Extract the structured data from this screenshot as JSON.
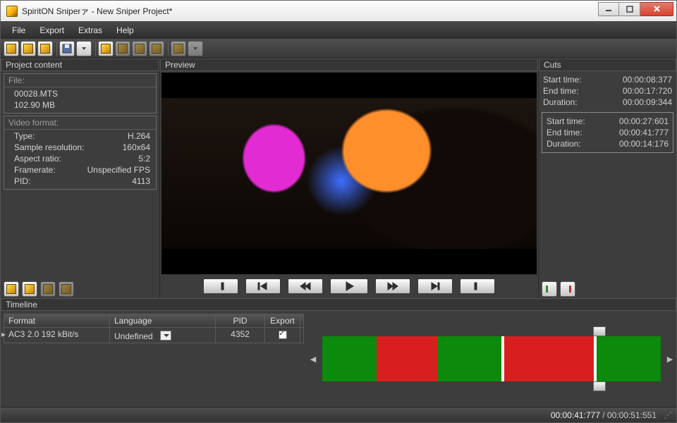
{
  "window": {
    "title": "SpiritON Sniperァ - New Sniper Project*"
  },
  "menubar": {
    "file": "File",
    "export": "Export",
    "extras": "Extras",
    "help": "Help"
  },
  "panes": {
    "project": "Project content",
    "preview": "Preview",
    "cuts": "Cuts",
    "timeline": "Timeline"
  },
  "project": {
    "file_head": "File:",
    "file_name": "00028.MTS",
    "file_size": "102.90 MB",
    "vf_head": "Video format:",
    "type_k": "Type:",
    "type_v": "H.264",
    "res_k": "Sample resolution:",
    "res_v": "160x64",
    "ar_k": "Aspect ratio:",
    "ar_v": "5:2",
    "fr_k": "Framerate:",
    "fr_v": "Unspecified FPS",
    "pid_k": "PID:",
    "pid_v": "4113"
  },
  "cuts": [
    {
      "start_k": "Start time:",
      "start_v": "00:00:08:377",
      "end_k": "End time:",
      "end_v": "00:00:17:720",
      "dur_k": "Duration:",
      "dur_v": "00:00:09:344",
      "selected": false
    },
    {
      "start_k": "Start time:",
      "start_v": "00:00:27:601",
      "end_k": "End time:",
      "end_v": "00:00:41:777",
      "dur_k": "Duration:",
      "dur_v": "00:00:14:176",
      "selected": true
    }
  ],
  "track_table": {
    "head": {
      "format": "Format",
      "language": "Language",
      "pid": "PID",
      "export": "Export"
    },
    "row": {
      "format": "AC3 2.0 192 kBit/s",
      "language": "Undefined",
      "pid": "4352",
      "export_checked": true
    }
  },
  "timeline": {
    "segments": [
      {
        "color": "g",
        "flex": 17
      },
      {
        "color": "r",
        "flex": 19
      },
      {
        "color": "g",
        "flex": 20,
        "gap_after": true
      },
      {
        "color": "r",
        "flex": 28,
        "gap_after": true
      },
      {
        "color": "g",
        "flex": 20
      }
    ],
    "playhead_pct": 80
  },
  "status": {
    "current": "00:00:41:777",
    "total": "00:00:51:551"
  }
}
